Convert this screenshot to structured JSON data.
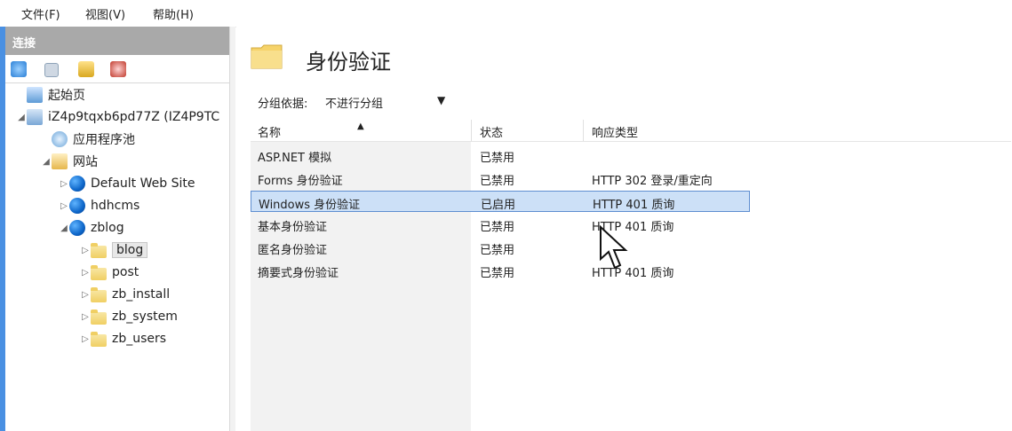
{
  "menubar": {
    "items": [
      {
        "label": "文件(F)"
      },
      {
        "label": "视图(V)"
      },
      {
        "label": "帮助(H)"
      }
    ]
  },
  "connections": {
    "title": "连接",
    "tree": [
      {
        "label": "起始页",
        "icon": "start-page-icon",
        "level": 0,
        "expander": ""
      },
      {
        "label": "iZ4p9tqxb6pd77Z (IZ4P9TC",
        "icon": "server-icon",
        "level": 0,
        "expander": "◢"
      },
      {
        "label": "应用程序池",
        "icon": "app-pool-icon",
        "level": 1,
        "expander": ""
      },
      {
        "label": "网站",
        "icon": "sites-icon",
        "level": 1,
        "expander": "◢"
      },
      {
        "label": "Default Web Site",
        "icon": "globe-icon",
        "level": 2,
        "expander": "▷"
      },
      {
        "label": "hdhcms",
        "icon": "globe-icon",
        "level": 2,
        "expander": "▷"
      },
      {
        "label": "zblog",
        "icon": "globe-icon",
        "level": 2,
        "expander": "◢"
      },
      {
        "label": "blog",
        "icon": "folder-icon",
        "level": 3,
        "expander": "▷",
        "selected": true
      },
      {
        "label": "post",
        "icon": "folder-icon",
        "level": 3,
        "expander": "▷"
      },
      {
        "label": "zb_install",
        "icon": "folder-icon",
        "level": 3,
        "expander": "▷"
      },
      {
        "label": "zb_system",
        "icon": "folder-icon",
        "level": 3,
        "expander": "▷"
      },
      {
        "label": "zb_users",
        "icon": "folder-icon",
        "level": 3,
        "expander": "▷"
      }
    ]
  },
  "main": {
    "title": "身份验证",
    "group_by_label": "分组依据:",
    "group_by_value": "不进行分组",
    "columns": [
      "名称",
      "状态",
      "响应类型"
    ],
    "rows": [
      {
        "name": "ASP.NET 模拟",
        "status": "已禁用",
        "response": ""
      },
      {
        "name": "Forms 身份验证",
        "status": "已禁用",
        "response": "HTTP 302 登录/重定向"
      },
      {
        "name": "Windows 身份验证",
        "status": "已启用",
        "response": "HTTP 401 质询",
        "selected": true
      },
      {
        "name": "基本身份验证",
        "status": "已禁用",
        "response": "HTTP 401 质询"
      },
      {
        "name": "匿名身份验证",
        "status": "已禁用",
        "response": ""
      },
      {
        "name": "摘要式身份验证",
        "status": "已禁用",
        "response": "HTTP 401 质询"
      }
    ]
  }
}
